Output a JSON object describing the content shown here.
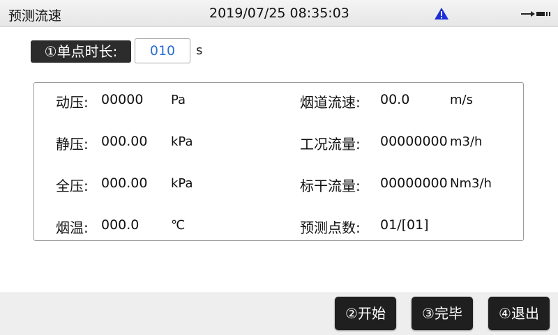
{
  "header": {
    "title": "预测流速",
    "datetime": "2019/07/25 08:35:03"
  },
  "duration": {
    "label": "①单点时长:",
    "value": "010",
    "unit": "s"
  },
  "measurements": {
    "dynamic_pressure": {
      "label": "动压:",
      "value": "00000",
      "unit": "Pa"
    },
    "static_pressure": {
      "label": "静压:",
      "value": "000.00",
      "unit": "kPa"
    },
    "total_pressure": {
      "label": "全压:",
      "value": "000.00",
      "unit": "kPa"
    },
    "flue_temp": {
      "label": "烟温:",
      "value": "000.0",
      "unit": "℃"
    },
    "flue_velocity": {
      "label": "烟道流速:",
      "value": "00.0",
      "unit": "m/s"
    },
    "working_flow": {
      "label": "工况流量:",
      "value": "00000000",
      "unit": "m3/h"
    },
    "standard_dry_flow": {
      "label": "标干流量:",
      "value": "00000000",
      "unit": "Nm3/h"
    },
    "predict_points": {
      "label": "预测点数:",
      "value": "01/[01]"
    }
  },
  "buttons": {
    "start": "②开始",
    "finish": "③完毕",
    "exit": "④退出"
  },
  "icons": {
    "warning": "warning-triangle-icon",
    "usb": "usb-icon"
  },
  "colors": {
    "warning": "#1c2fd6",
    "input_text": "#2c6fd8",
    "button_bg": "#1f1f1f"
  }
}
